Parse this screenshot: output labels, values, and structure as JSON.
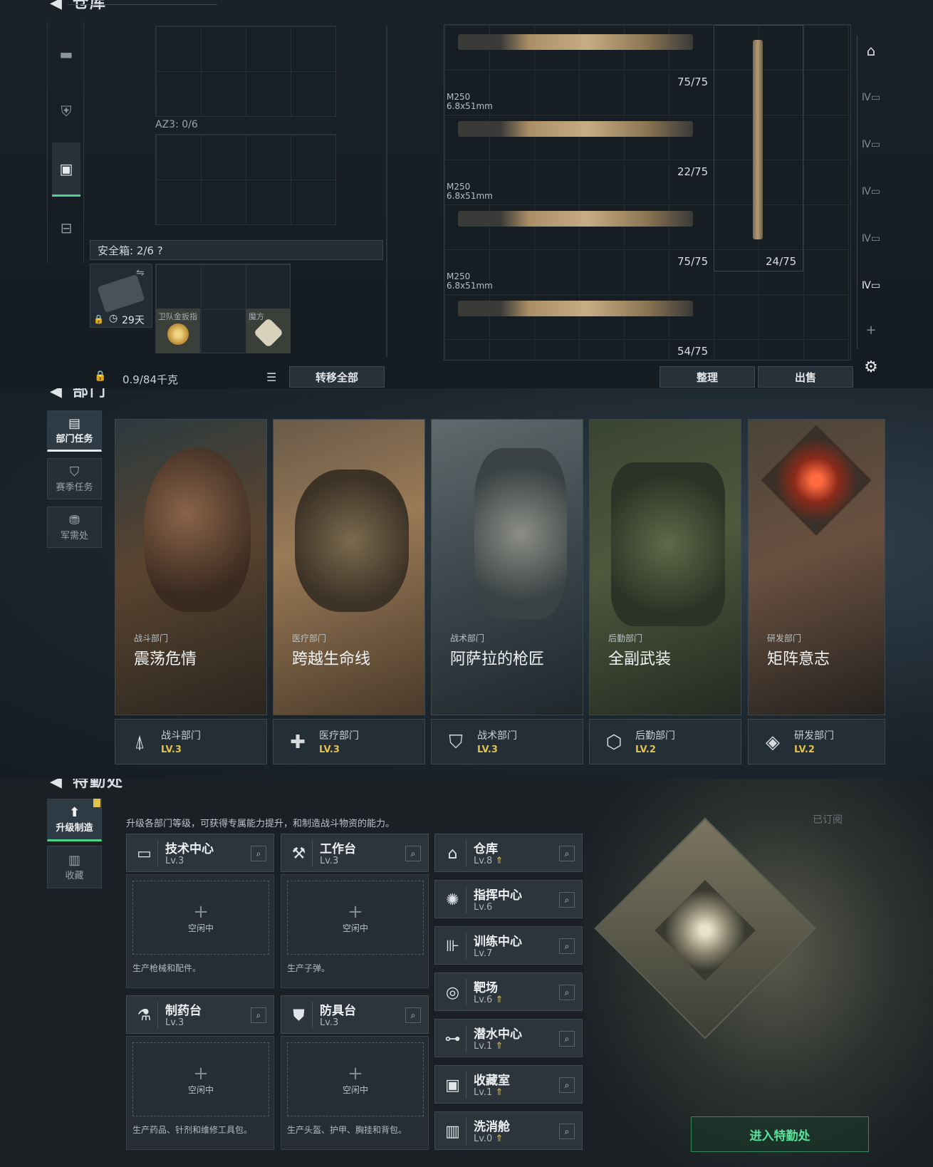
{
  "warehouse": {
    "title": "仓库",
    "back_icon": "back-arrow-icon",
    "nav_icons": [
      "weapon-icon",
      "armor-icon",
      "backpack-icon",
      "toolbox-icon"
    ],
    "az3_label": "AZ3: 0/6",
    "safebox_label": "安全箱: 2/6 ?",
    "safebox_days": "29天",
    "slot_items": [
      "卫队金扳指",
      "魔方"
    ],
    "weight": "0.9/84千克",
    "transfer_all": "转移全部",
    "weapons": [
      {
        "name": "",
        "caliber": "",
        "count": "75/75"
      },
      {
        "name": "M250",
        "caliber": "6.8x51mm",
        "count": "22/75"
      },
      {
        "name": "M250",
        "caliber": "6.8x51mm",
        "count": "75/75"
      },
      {
        "name": "M250",
        "caliber": "6.8x51mm",
        "count": "54/75"
      }
    ],
    "tall_weapon_count": "24/75",
    "arrange_button": "整理",
    "sell_button": "出售",
    "right_nav_icons": [
      "locker-icon",
      "iv-armor-icon",
      "iv-rig-icon",
      "iv-plate-icon",
      "iv-helmet-icon",
      "iv-backpack-icon",
      "add-icon",
      "settings-icon"
    ]
  },
  "departments": {
    "title": "部门",
    "side_nav": [
      {
        "label": "部门任务",
        "icon": "task-icon"
      },
      {
        "label": "赛季任务",
        "icon": "season-icon"
      },
      {
        "label": "军需处",
        "icon": "supply-icon"
      }
    ],
    "cards": [
      {
        "category": "战斗部门",
        "name": "震荡危情",
        "dept": "战斗部门",
        "level": "LV.3",
        "icon": "combat-dept-icon",
        "color": "#7a5a3a"
      },
      {
        "category": "医疗部门",
        "name": "跨越生命线",
        "dept": "医疗部门",
        "level": "LV.3",
        "icon": "medical-dept-icon",
        "color": "#8a6a48"
      },
      {
        "category": "战术部门",
        "name": "阿萨拉的枪匠",
        "dept": "战术部门",
        "level": "LV.3",
        "icon": "tactical-dept-icon",
        "color": "#4d5a5e"
      },
      {
        "category": "后勤部门",
        "name": "全副武装",
        "dept": "后勤部门",
        "level": "LV.2",
        "icon": "logistics-dept-icon",
        "color": "#4f5a3c"
      },
      {
        "category": "研发部门",
        "name": "矩阵意志",
        "dept": "研发部门",
        "level": "LV.2",
        "icon": "research-dept-icon",
        "color": "#5e4a3a"
      }
    ]
  },
  "special_ops": {
    "title": "特勤处",
    "side_nav": [
      {
        "label": "升级制造",
        "icon": "upgrade-icon"
      },
      {
        "label": "收藏",
        "icon": "collection-icon"
      }
    ],
    "description": "升级各部门等级，可获得专属能力提升，和制造战斗物资的能力。",
    "subscribed": "已订阅",
    "workshops": [
      {
        "name": "技术中心",
        "level": "Lv.3",
        "icon": "computer-icon",
        "status": "空闲中",
        "note": "生产枪械和配件。"
      },
      {
        "name": "工作台",
        "level": "Lv.3",
        "icon": "tools-icon",
        "status": "空闲中",
        "note": "生产子弹。"
      },
      {
        "name": "制药台",
        "level": "Lv.3",
        "icon": "medicine-icon",
        "status": "空闲中",
        "note": "生产药品、针剂和维修工具包。"
      },
      {
        "name": "防具台",
        "level": "Lv.3",
        "icon": "armor-bench-icon",
        "status": "空闲中",
        "note": "生产头盔、护甲、胸挂和背包。"
      }
    ],
    "facilities": [
      {
        "name": "仓库",
        "level": "Lv.8",
        "icon": "warehouse-icon",
        "upgrade": true
      },
      {
        "name": "指挥中心",
        "level": "Lv.6",
        "icon": "command-icon",
        "upgrade": false
      },
      {
        "name": "训练中心",
        "level": "Lv.7",
        "icon": "training-icon",
        "upgrade": false
      },
      {
        "name": "靶场",
        "level": "Lv.6",
        "icon": "range-icon",
        "upgrade": true
      },
      {
        "name": "潜水中心",
        "level": "Lv.1",
        "icon": "diving-icon",
        "upgrade": true
      },
      {
        "name": "收藏室",
        "level": "Lv.1",
        "icon": "collection-room-icon",
        "upgrade": true
      },
      {
        "name": "洗消舱",
        "level": "Lv.0",
        "icon": "decon-icon",
        "upgrade": true
      }
    ],
    "enter_button": "进入特勤处"
  }
}
